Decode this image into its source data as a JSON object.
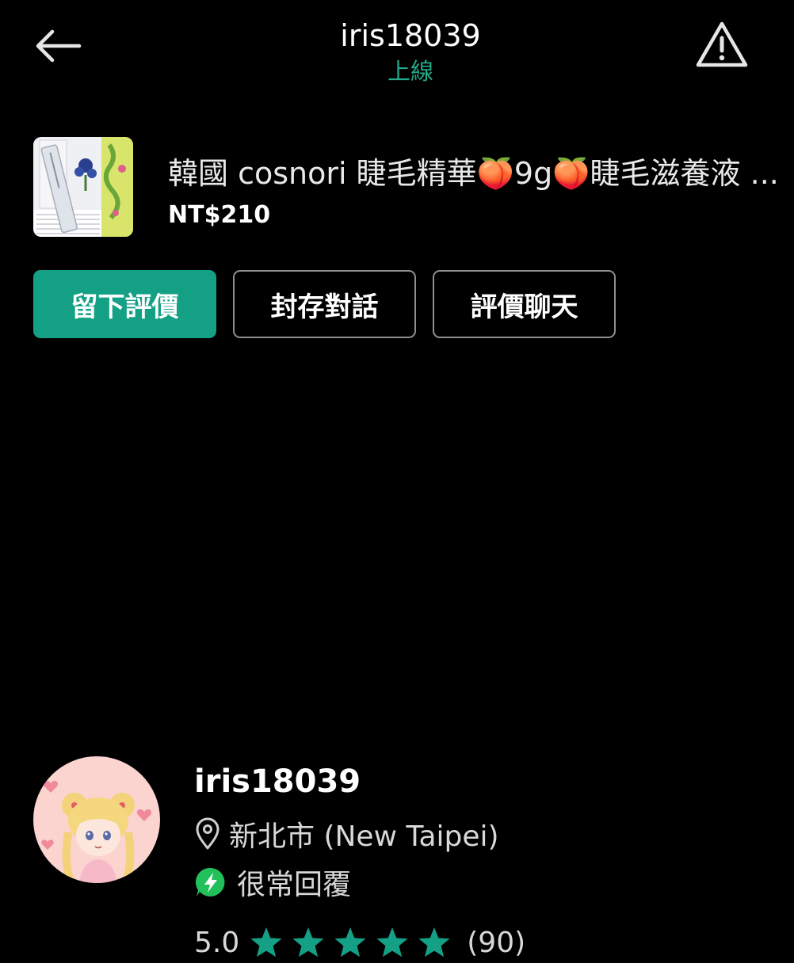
{
  "colors": {
    "accent": "#14a085",
    "online": "#22a98a",
    "background": "#000000",
    "button_border": "#8f8f8f"
  },
  "header": {
    "back_icon": "arrow-left-icon",
    "title": "iris18039",
    "status": "上線",
    "report_icon": "warning-triangle-icon"
  },
  "product": {
    "thumbnail_icon": "product-photo",
    "title": "韓國 cosnori 睫毛精華🍑9g🍑睫毛滋養液 ...",
    "price": "NT$210"
  },
  "actions": [
    {
      "label": "留下評價",
      "style": "primary"
    },
    {
      "label": "封存對話",
      "style": "outline"
    },
    {
      "label": "評價聊天",
      "style": "outline"
    }
  ],
  "seller": {
    "avatar_icon": "seller-avatar",
    "name": "iris18039",
    "location_icon": "location-pin-icon",
    "location": "新北市 (New Taipei)",
    "response_icon": "lightning-bolt-icon",
    "response": "很常回覆",
    "rating": "5.0",
    "rating_stars": 5,
    "review_count": "(90)"
  }
}
